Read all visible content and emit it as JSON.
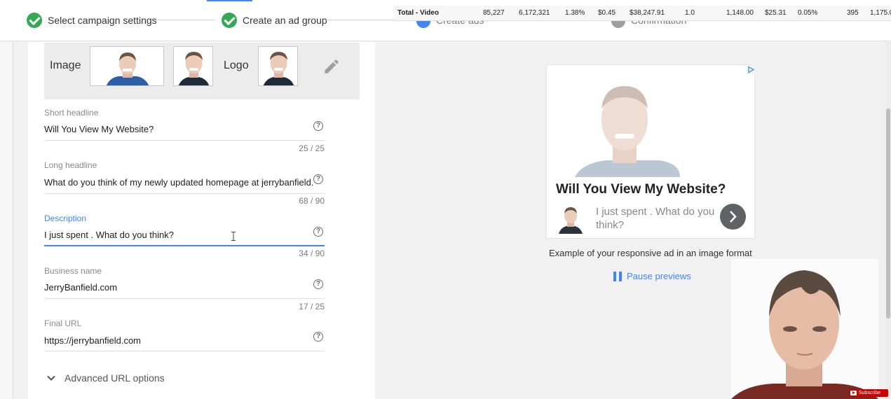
{
  "stepper": {
    "step1": "Select campaign settings",
    "step2": "Create an ad group",
    "step3": "Create ads",
    "step4": "Confirmation"
  },
  "stats": {
    "label": "Total - Video",
    "values": [
      "85,227",
      "6,172,321",
      "1.38%",
      "$0.45",
      "$38,247.91",
      "1.0",
      "1,148.00",
      "$25.31",
      "0.05%",
      "395",
      "1,175.0"
    ]
  },
  "assets": {
    "image_label": "Image",
    "logo_label": "Logo"
  },
  "fields": {
    "short_headline": {
      "label": "Short headline",
      "value": "Will You View My Website?",
      "counter": "25 / 25"
    },
    "long_headline": {
      "label": "Long headline",
      "value": "What do you think of my newly updated homepage at jerrybanfield.",
      "counter": "68 / 90"
    },
    "description": {
      "label": "Description",
      "value": "I just spent .  What do you think?",
      "counter": "34 / 90"
    },
    "business_name": {
      "label": "Business name",
      "value": "JerryBanfield.com",
      "counter": "17 / 25"
    },
    "final_url": {
      "label": "Final URL",
      "value": "https://jerrybanfield.com"
    },
    "help_glyph": "?"
  },
  "advanced": {
    "label": "Advanced URL options"
  },
  "preview": {
    "headline": "Will You View My Website?",
    "description": "I just spent . What do you think?",
    "caption": "Example of your responsive ad in an image format",
    "pause_label": "Pause previews"
  },
  "subscribe": {
    "label": "Subscribe"
  },
  "colors": {
    "accent_blue": "#4285f4",
    "check_green": "#34a853",
    "youtube_red": "#cc0000"
  },
  "icons": [
    "check-icon",
    "pencil-icon",
    "help-icon",
    "chevron-down-icon",
    "chevron-right-icon",
    "pause-icon",
    "adchoices-icon",
    "text-cursor-icon",
    "youtube-icon"
  ]
}
